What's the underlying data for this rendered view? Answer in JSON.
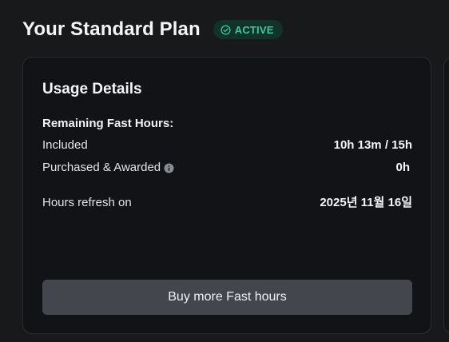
{
  "header": {
    "title": "Your Standard Plan",
    "badge": {
      "label": "ACTIVE",
      "icon": "check-circle-icon",
      "text_color": "#3fc79a",
      "background": "#12332a"
    }
  },
  "usage": {
    "title": "Usage Details",
    "section_label": "Remaining Fast Hours:",
    "rows": [
      {
        "label": "Included",
        "value": "10h 13m / 15h"
      },
      {
        "label": "Purchased & Awarded",
        "value": "0h",
        "icon": "info-icon"
      },
      {
        "label": "Hours refresh on",
        "value": "2025년 11월 16일"
      }
    ],
    "button_label": "Buy more Fast hours"
  },
  "colors": {
    "background": "#18191b",
    "card": "#121316",
    "button": "#44464e"
  }
}
